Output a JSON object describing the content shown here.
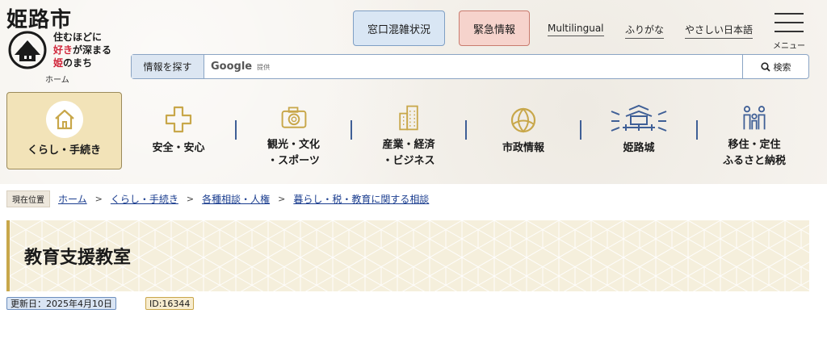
{
  "header": {
    "site_title": "姫路市",
    "slogan_line1": "住むほどに",
    "slogan_line2a": "好き",
    "slogan_line2b": "が深まる",
    "slogan_line3a": "姫",
    "slogan_line3b": "のまち",
    "home_label": "ホーム",
    "madoguchi_label": "窓口混雑状況",
    "kinkyu_label": "緊急情報",
    "multilingual_label": "Multilingual",
    "furigana_label": "ふりがな",
    "yasashii_label": "やさしい日本語",
    "menu_label": "メニュー"
  },
  "search": {
    "label": "情報を探す",
    "provider": "Google",
    "provider_sub": "提供",
    "button_label": "検索"
  },
  "nav": {
    "items": [
      {
        "label": "くらし・手続き",
        "icon": "house-icon"
      },
      {
        "label": "安全・安心",
        "icon": "cross-icon"
      },
      {
        "label_line1": "観光・文化",
        "label_line2": "・スポーツ",
        "icon": "camera-icon"
      },
      {
        "label_line1": "産業・経済",
        "label_line2": "・ビジネス",
        "icon": "building-icon"
      },
      {
        "label": "市政情報",
        "icon": "emblem-icon"
      },
      {
        "label": "姫路城",
        "icon": "castle-icon"
      },
      {
        "label_line1": "移住・定住",
        "label_line2": "ふるさと納税",
        "icon": "family-icon"
      }
    ]
  },
  "breadcrumb": {
    "current_tag": "現在位置",
    "items": [
      "ホーム",
      "くらし・手続き",
      "各種相談・人権",
      "暮らし・税・教育に関する相談"
    ]
  },
  "page": {
    "title": "教育支援教室",
    "updated": "更新日：2025年4月10日",
    "id": "ID:16344"
  },
  "colors": {
    "accent_blue": "#3f5f96",
    "accent_gold": "#c8a74a",
    "link_blue": "#1a3d8f",
    "slogan_red": "#d0253a"
  }
}
